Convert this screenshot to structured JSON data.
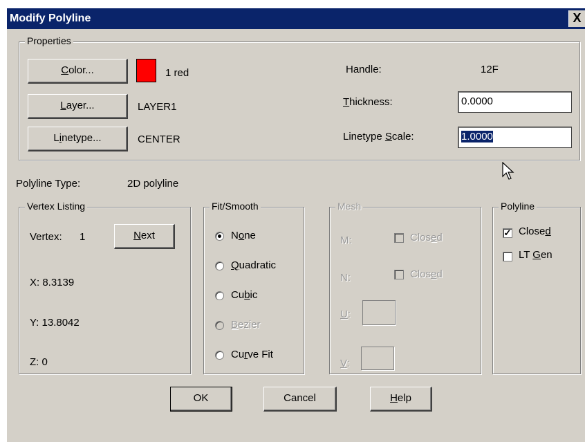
{
  "window": {
    "title": "Modify Polyline",
    "close_glyph": "X"
  },
  "properties": {
    "legend": "Properties",
    "color_button": {
      "pre": "",
      "mn": "C",
      "post": "olor..."
    },
    "color_value": "1 red",
    "color_swatch": "#ff0000",
    "layer_button": {
      "pre": "",
      "mn": "L",
      "post": "ayer..."
    },
    "layer_value": "LAYER1",
    "linetype_button": {
      "pre": "L",
      "mn": "i",
      "post": "netype..."
    },
    "linetype_value": "CENTER",
    "handle_label": "Handle:",
    "handle_value": "12F",
    "thickness_label": {
      "pre": "",
      "mn": "T",
      "post": "hickness:"
    },
    "thickness_value": "0.0000",
    "ltscale_label": {
      "pre": "Linetype ",
      "mn": "S",
      "post": "cale:"
    },
    "ltscale_value": "1.0000"
  },
  "polyline_type": {
    "label": "Polyline Type:",
    "value": "2D polyline"
  },
  "vertex_listing": {
    "legend": "Vertex Listing",
    "vertex_label": "Vertex:",
    "vertex_value": "1",
    "next_button": {
      "pre": "",
      "mn": "N",
      "post": "ext"
    },
    "x": "X:  8.3139",
    "y": "Y:  13.8042",
    "z": "Z:  0"
  },
  "fit_smooth": {
    "legend": "Fit/Smooth",
    "options": [
      {
        "pre": "N",
        "mn": "o",
        "post": "ne",
        "selected": true,
        "disabled": false
      },
      {
        "pre": "",
        "mn": "Q",
        "post": "uadratic",
        "selected": false,
        "disabled": false
      },
      {
        "pre": "Cu",
        "mn": "b",
        "post": "ic",
        "selected": false,
        "disabled": false
      },
      {
        "pre": "",
        "mn": "B",
        "post": "ezier",
        "selected": false,
        "disabled": true
      },
      {
        "pre": "Cu",
        "mn": "r",
        "post": "ve Fit",
        "selected": false,
        "disabled": false
      }
    ]
  },
  "mesh": {
    "legend": "Mesh",
    "m_label": "M:",
    "m_closed": {
      "pre": "Clos",
      "mn": "e",
      "post": "d"
    },
    "n_label": "N:",
    "n_closed": {
      "pre": "Clos",
      "mn": "e",
      "post": "d"
    },
    "u_label": {
      "pre": "",
      "mn": "U",
      "post": ":"
    },
    "v_label": {
      "pre": "",
      "mn": "V",
      "post": ":"
    }
  },
  "polyline": {
    "legend": "Polyline",
    "closed": {
      "pre": "Close",
      "mn": "d",
      "post": "",
      "checked": true
    },
    "ltgen": {
      "pre": "LT ",
      "mn": "G",
      "post": "en",
      "checked": false
    }
  },
  "footer": {
    "ok": "OK",
    "cancel": "Cancel",
    "help": {
      "pre": "",
      "mn": "H",
      "post": "elp"
    }
  },
  "icons": {
    "check_glyph": "✓"
  }
}
